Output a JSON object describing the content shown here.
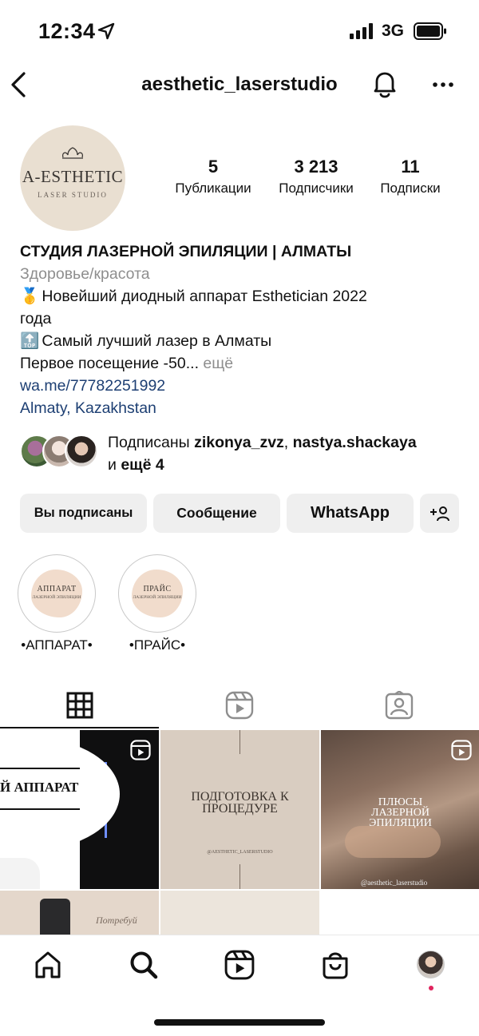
{
  "status_bar": {
    "time": "12:34",
    "network": "3G"
  },
  "header": {
    "username": "aesthetic_laserstudio"
  },
  "profile": {
    "avatar_brand": "A-ESTHETIC",
    "avatar_subtitle": "LASER STUDIO",
    "stats": [
      {
        "value": "5",
        "label": "Публикации"
      },
      {
        "value": "3 213",
        "label": "Подписчики"
      },
      {
        "value": "11",
        "label": "Подписки"
      }
    ]
  },
  "bio": {
    "name": "СТУДИЯ ЛАЗЕРНОЙ ЭПИЛЯЦИИ | АЛМАТЫ",
    "category": "Здоровье/красота",
    "line1_emoji": "🥇",
    "line1": "Новейший диодный аппарат Esthetician 2022",
    "line1_cont": "года",
    "line2_emoji": "🔝",
    "line2": "Самый лучший лазер в Алматы",
    "line3": "Первое посещение -50...",
    "more": "ещё",
    "link": "wa.me/77782251992",
    "location": "Almaty, Kazakhstan"
  },
  "followed_by": {
    "prefix": "Подписаны",
    "user1": "zikonya_zvz",
    "sep": ",",
    "user2": "nastya.shackaya",
    "and": "и",
    "more": "ещё 4"
  },
  "actions": {
    "following": "Вы подписаны",
    "message": "Сообщение",
    "whatsapp": "WhatsApp"
  },
  "highlights": [
    {
      "title_in": "АППАРАТ",
      "sub_in": "ЛАЗЕРНОЙ ЭПИЛЯЦИИ",
      "caption": "•АППАРАТ•"
    },
    {
      "title_in": "ПРАЙС",
      "sub_in": "ЛАЗЕРНОЙ ЭПИЛЯЦИИ",
      "caption": "•ПРАЙС•"
    }
  ],
  "posts": [
    {
      "text": "Й АППАРАТ"
    },
    {
      "text1": "ПОДГОТОВКА К",
      "text2": "ПРОЦЕДУРЕ",
      "handle": "@AESTHETIC_LASERSTUDIO"
    },
    {
      "text1": "ПЛЮСЫ",
      "text2": "ЛАЗЕРНОЙ",
      "text3": "ЭПИЛЯЦИИ",
      "handle": "@aesthetic_laserstudio"
    },
    {
      "script": "Потребуй"
    }
  ],
  "colors": {
    "link": "#1d3f73",
    "button_bg": "#efefef",
    "muted": "#8e8e8e",
    "notification_dot": "#e0245e"
  }
}
